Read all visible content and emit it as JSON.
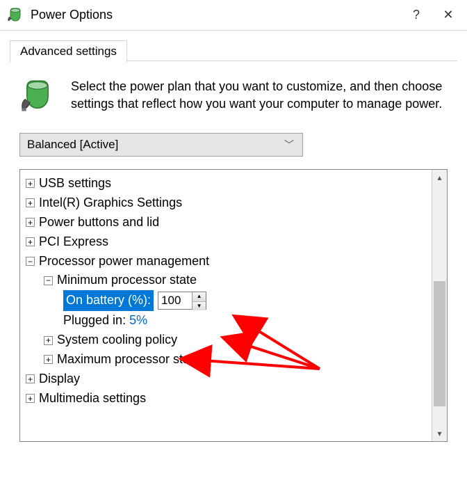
{
  "titlebar": {
    "title": "Power Options",
    "help_symbol": "?",
    "close_symbol": "✕"
  },
  "tab": {
    "label": "Advanced settings"
  },
  "intro": {
    "text": "Select the power plan that you want to customize, and then choose settings that reflect how you want your computer to manage power."
  },
  "plan_select": {
    "value": "Balanced [Active]"
  },
  "tree": {
    "usb": "USB settings",
    "intel": "Intel(R) Graphics Settings",
    "buttons": "Power buttons and lid",
    "pci": "PCI Express",
    "proc": "Processor power management",
    "min_state": "Minimum processor state",
    "on_battery_label": "On battery (%):",
    "on_battery_value": "100",
    "plugged_label": "Plugged in:",
    "plugged_value": "5%",
    "cooling": "System cooling policy",
    "max_state": "Maximum processor state",
    "display": "Display",
    "multimedia": "Multimedia settings"
  }
}
